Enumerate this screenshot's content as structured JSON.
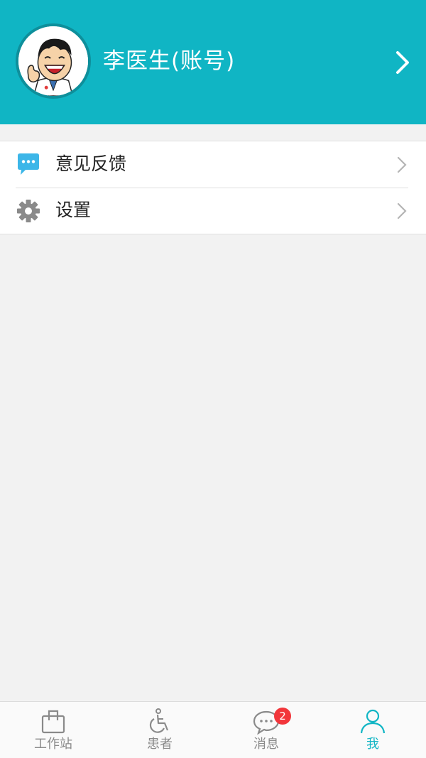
{
  "profile": {
    "name": "李医生(账号)",
    "avatar": "cartoon-doctor-avatar"
  },
  "menu": {
    "items": [
      {
        "label": "意见反馈",
        "icon": "feedback-chat-icon",
        "icon_color": "#3cb6e8"
      },
      {
        "label": "设置",
        "icon": "gear-icon",
        "icon_color": "#8a8a8a"
      }
    ]
  },
  "tabs": [
    {
      "label": "工作站",
      "icon": "briefcase-icon",
      "active": false
    },
    {
      "label": "患者",
      "icon": "wheelchair-icon",
      "active": false
    },
    {
      "label": "消息",
      "icon": "chat-bubble-icon",
      "active": false,
      "badge": "2"
    },
    {
      "label": "我",
      "icon": "person-icon",
      "active": true
    }
  ],
  "colors": {
    "accent": "#10b5c4",
    "badge": "#f2363b",
    "background": "#f2f2f2"
  }
}
